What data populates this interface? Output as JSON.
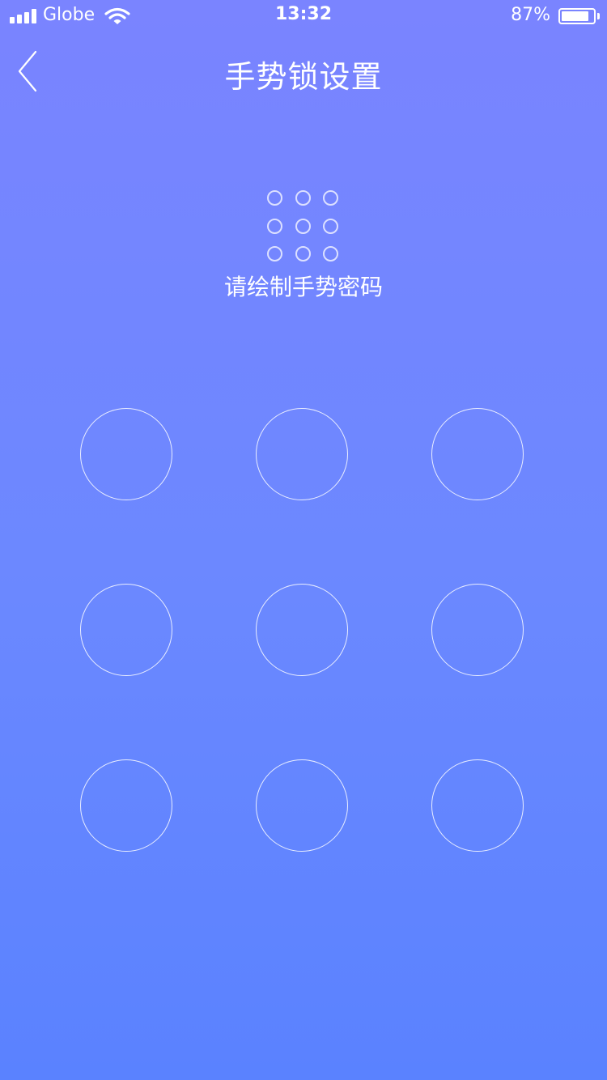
{
  "status_bar": {
    "carrier": "Globe",
    "time": "13:32",
    "battery_percent": "87%",
    "battery_level": 0.87,
    "signal_icon": "signal-bars-icon",
    "wifi_icon": "wifi-icon",
    "battery_icon": "battery-icon"
  },
  "nav": {
    "title": "手势锁设置",
    "back_icon": "chevron-left-icon"
  },
  "preview": {
    "dots": [
      0,
      0,
      0,
      0,
      0,
      0,
      0,
      0,
      0
    ]
  },
  "hint": "请绘制手势密码",
  "gesture_pad": {
    "nodes": [
      1,
      2,
      3,
      4,
      5,
      6,
      7,
      8,
      9
    ]
  },
  "colors": {
    "background_top": "#7a84ff",
    "background_bottom": "#5a82ff",
    "foreground": "#ffffff"
  }
}
